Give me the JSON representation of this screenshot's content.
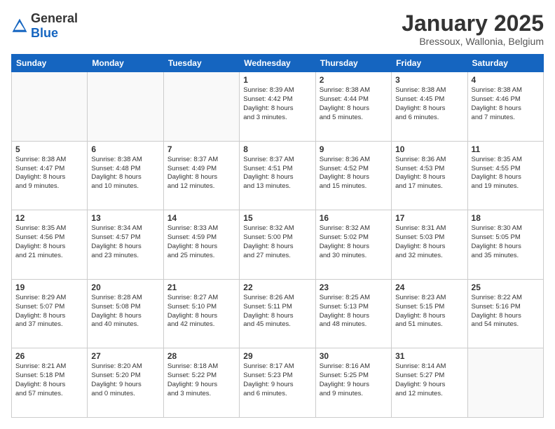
{
  "logo": {
    "general": "General",
    "blue": "Blue"
  },
  "header": {
    "title": "January 2025",
    "subtitle": "Bressoux, Wallonia, Belgium"
  },
  "days": [
    "Sunday",
    "Monday",
    "Tuesday",
    "Wednesday",
    "Thursday",
    "Friday",
    "Saturday"
  ],
  "weeks": [
    [
      {
        "day": "",
        "info": ""
      },
      {
        "day": "",
        "info": ""
      },
      {
        "day": "",
        "info": ""
      },
      {
        "day": "1",
        "info": "Sunrise: 8:39 AM\nSunset: 4:42 PM\nDaylight: 8 hours\nand 3 minutes."
      },
      {
        "day": "2",
        "info": "Sunrise: 8:38 AM\nSunset: 4:44 PM\nDaylight: 8 hours\nand 5 minutes."
      },
      {
        "day": "3",
        "info": "Sunrise: 8:38 AM\nSunset: 4:45 PM\nDaylight: 8 hours\nand 6 minutes."
      },
      {
        "day": "4",
        "info": "Sunrise: 8:38 AM\nSunset: 4:46 PM\nDaylight: 8 hours\nand 7 minutes."
      }
    ],
    [
      {
        "day": "5",
        "info": "Sunrise: 8:38 AM\nSunset: 4:47 PM\nDaylight: 8 hours\nand 9 minutes."
      },
      {
        "day": "6",
        "info": "Sunrise: 8:38 AM\nSunset: 4:48 PM\nDaylight: 8 hours\nand 10 minutes."
      },
      {
        "day": "7",
        "info": "Sunrise: 8:37 AM\nSunset: 4:49 PM\nDaylight: 8 hours\nand 12 minutes."
      },
      {
        "day": "8",
        "info": "Sunrise: 8:37 AM\nSunset: 4:51 PM\nDaylight: 8 hours\nand 13 minutes."
      },
      {
        "day": "9",
        "info": "Sunrise: 8:36 AM\nSunset: 4:52 PM\nDaylight: 8 hours\nand 15 minutes."
      },
      {
        "day": "10",
        "info": "Sunrise: 8:36 AM\nSunset: 4:53 PM\nDaylight: 8 hours\nand 17 minutes."
      },
      {
        "day": "11",
        "info": "Sunrise: 8:35 AM\nSunset: 4:55 PM\nDaylight: 8 hours\nand 19 minutes."
      }
    ],
    [
      {
        "day": "12",
        "info": "Sunrise: 8:35 AM\nSunset: 4:56 PM\nDaylight: 8 hours\nand 21 minutes."
      },
      {
        "day": "13",
        "info": "Sunrise: 8:34 AM\nSunset: 4:57 PM\nDaylight: 8 hours\nand 23 minutes."
      },
      {
        "day": "14",
        "info": "Sunrise: 8:33 AM\nSunset: 4:59 PM\nDaylight: 8 hours\nand 25 minutes."
      },
      {
        "day": "15",
        "info": "Sunrise: 8:32 AM\nSunset: 5:00 PM\nDaylight: 8 hours\nand 27 minutes."
      },
      {
        "day": "16",
        "info": "Sunrise: 8:32 AM\nSunset: 5:02 PM\nDaylight: 8 hours\nand 30 minutes."
      },
      {
        "day": "17",
        "info": "Sunrise: 8:31 AM\nSunset: 5:03 PM\nDaylight: 8 hours\nand 32 minutes."
      },
      {
        "day": "18",
        "info": "Sunrise: 8:30 AM\nSunset: 5:05 PM\nDaylight: 8 hours\nand 35 minutes."
      }
    ],
    [
      {
        "day": "19",
        "info": "Sunrise: 8:29 AM\nSunset: 5:07 PM\nDaylight: 8 hours\nand 37 minutes."
      },
      {
        "day": "20",
        "info": "Sunrise: 8:28 AM\nSunset: 5:08 PM\nDaylight: 8 hours\nand 40 minutes."
      },
      {
        "day": "21",
        "info": "Sunrise: 8:27 AM\nSunset: 5:10 PM\nDaylight: 8 hours\nand 42 minutes."
      },
      {
        "day": "22",
        "info": "Sunrise: 8:26 AM\nSunset: 5:11 PM\nDaylight: 8 hours\nand 45 minutes."
      },
      {
        "day": "23",
        "info": "Sunrise: 8:25 AM\nSunset: 5:13 PM\nDaylight: 8 hours\nand 48 minutes."
      },
      {
        "day": "24",
        "info": "Sunrise: 8:23 AM\nSunset: 5:15 PM\nDaylight: 8 hours\nand 51 minutes."
      },
      {
        "day": "25",
        "info": "Sunrise: 8:22 AM\nSunset: 5:16 PM\nDaylight: 8 hours\nand 54 minutes."
      }
    ],
    [
      {
        "day": "26",
        "info": "Sunrise: 8:21 AM\nSunset: 5:18 PM\nDaylight: 8 hours\nand 57 minutes."
      },
      {
        "day": "27",
        "info": "Sunrise: 8:20 AM\nSunset: 5:20 PM\nDaylight: 9 hours\nand 0 minutes."
      },
      {
        "day": "28",
        "info": "Sunrise: 8:18 AM\nSunset: 5:22 PM\nDaylight: 9 hours\nand 3 minutes."
      },
      {
        "day": "29",
        "info": "Sunrise: 8:17 AM\nSunset: 5:23 PM\nDaylight: 9 hours\nand 6 minutes."
      },
      {
        "day": "30",
        "info": "Sunrise: 8:16 AM\nSunset: 5:25 PM\nDaylight: 9 hours\nand 9 minutes."
      },
      {
        "day": "31",
        "info": "Sunrise: 8:14 AM\nSunset: 5:27 PM\nDaylight: 9 hours\nand 12 minutes."
      },
      {
        "day": "",
        "info": ""
      }
    ]
  ]
}
